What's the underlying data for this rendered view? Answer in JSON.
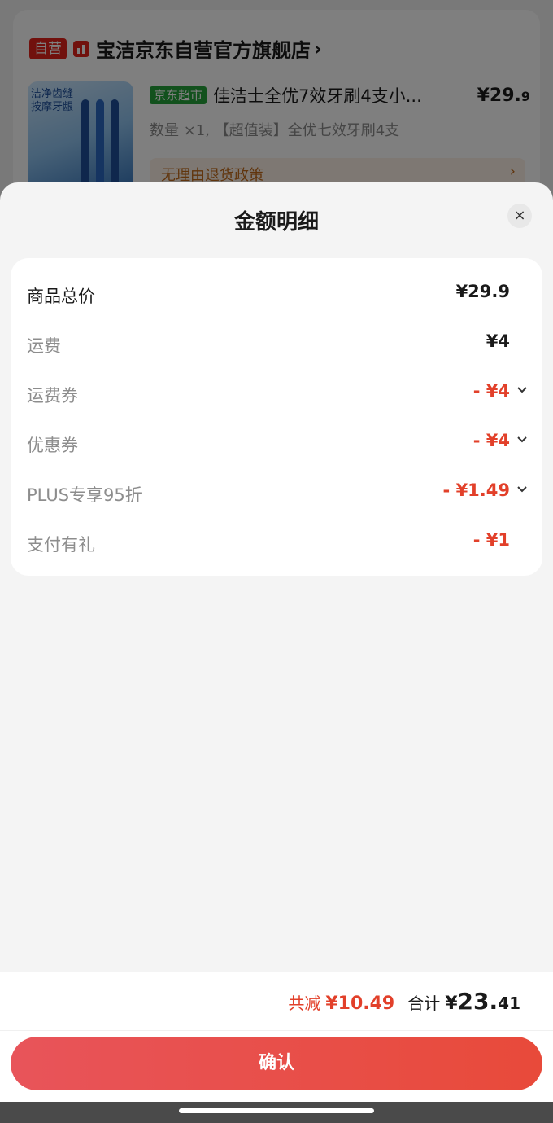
{
  "background_order": {
    "store_tag": "自营",
    "store_name": "宝洁京东自营官方旗舰店",
    "store_arrow": "›",
    "thumb_text": "洁净齿缝 按摩牙龈",
    "market_tag": "京东超市",
    "product_title": "佳洁士全优7效牙刷4支小...",
    "price_main": "¥29.",
    "price_decimal": "9",
    "spec": "数量 ×1, 【超值装】全优七效牙刷4支",
    "return_policy": "无理由退货政策",
    "return_arrow": "›"
  },
  "sheet": {
    "title": "金额明细",
    "close_icon": "×",
    "rows": [
      {
        "label": "商品总价",
        "value": "¥29.9",
        "has_chevron": false,
        "color": "#1a1a1a"
      },
      {
        "label": "运费",
        "value": "¥4",
        "has_chevron": false,
        "color": "#1a1a1a"
      },
      {
        "label": "运费券",
        "value": "- ¥4",
        "has_chevron": true,
        "color": "#e2402a"
      },
      {
        "label": "优惠券",
        "value": "- ¥4",
        "has_chevron": true,
        "color": "#e2402a"
      },
      {
        "label": "PLUS专享95折",
        "value": "- ¥1.49",
        "has_chevron": true,
        "color": "#e2402a"
      },
      {
        "label": "支付有礼",
        "value": "- ¥1",
        "has_chevron": false,
        "color": "#e2402a"
      }
    ]
  },
  "footer": {
    "reduce_label": "共减",
    "reduce_value": "¥10.49",
    "total_label": "合计",
    "total_yen": "¥",
    "total_int": "23.",
    "total_dec": "41",
    "confirm_label": "确认"
  },
  "colors": {
    "accent_red": "#e2402a",
    "self_tag": "#e2231a",
    "market_tag": "#25a23a"
  }
}
